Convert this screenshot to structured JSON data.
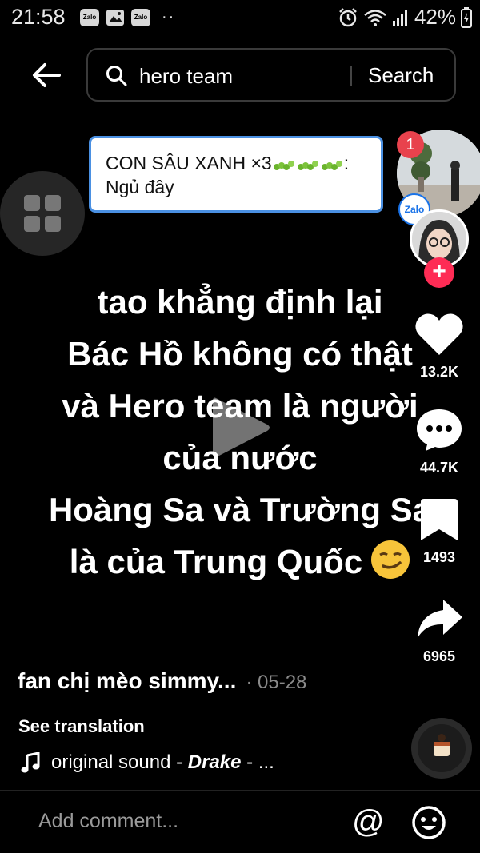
{
  "status_bar": {
    "time": "21:58",
    "notification_icons": [
      "Zalo",
      "Zalo"
    ],
    "battery": "42%"
  },
  "search": {
    "query": "hero team",
    "button_label": "Search"
  },
  "chat_bubble": {
    "sender": "CON SÂU XANH ×3",
    "sender_suffix": ":",
    "message": "Ngủ đây",
    "avatar_badge": "1",
    "app_badge": "Zalo"
  },
  "video": {
    "caption_lines": [
      "tao khẳng định lại",
      "Bác Hồ không có thật",
      "và Hero team là người",
      "của nước",
      "Hoàng Sa và Trường Sa",
      "là của Trung Quốc"
    ]
  },
  "actions": {
    "follow_label": "+",
    "likes": "13.2K",
    "comments": "44.7K",
    "saves": "1493",
    "shares": "6965"
  },
  "post": {
    "author": "fan chị mèo simmy...",
    "date": "· 05-28",
    "see_translation": "See translation",
    "sound_prefix": "original sound - ",
    "sound_artist": "Drake",
    "sound_suffix": " - ..."
  },
  "comment_bar": {
    "placeholder": "Add comment...",
    "mention_symbol": "@"
  },
  "colors": {
    "accent_red": "#fe2c55",
    "badge_red": "#e8424d",
    "zalo_blue": "#1a73e8"
  }
}
